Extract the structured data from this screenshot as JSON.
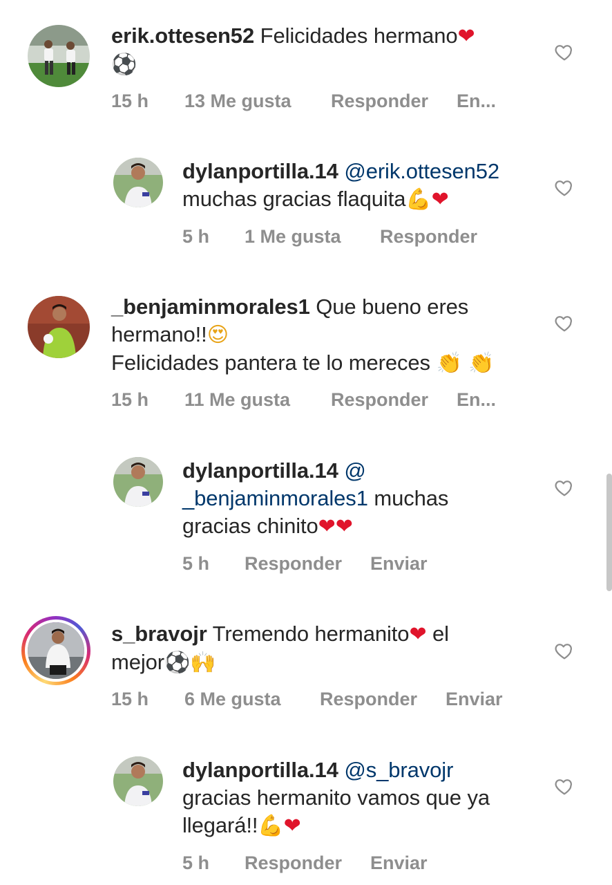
{
  "comments": [
    {
      "username": "erik.ottesen52",
      "text": " Felicidades hermano",
      "emoji1": "❤",
      "line2_emoji": "⚽",
      "time": "15 h",
      "likes": "13 Me gusta",
      "reply": "Responder",
      "send": "En..."
    },
    {
      "username": "dylanportilla.14",
      "mention": "@erik.ottesen52",
      "line2": "muchas gracias flaquita",
      "emoji_flex": "💪",
      "emoji_heart": "❤",
      "time": "5 h",
      "likes": "1 Me gusta",
      "reply": "Responder"
    },
    {
      "username": "_benjaminmorales1",
      "text": " Que bueno eres",
      "line2": "hermano!!",
      "emoji_eyes": "😍",
      "line3": "Felicidades pantera te lo mereces ",
      "emoji_clap": "👏 👏",
      "time": "15 h",
      "likes": "11 Me gusta",
      "reply": "Responder",
      "send": "En..."
    },
    {
      "username": "dylanportilla.14",
      "mention1": "@",
      "mention2": "_benjaminmorales1",
      "text2": " muchas",
      "line3": "gracias chinito",
      "emoji_hearts": "❤❤",
      "time": "5 h",
      "reply": "Responder",
      "send": "Enviar"
    },
    {
      "username": "s_bravojr",
      "text": " Tremendo hermanito",
      "emoji_heart": "❤",
      "text_after": " el",
      "line2": "mejor",
      "emoji_ball": "⚽",
      "emoji_hands": "🙌",
      "time": "15 h",
      "likes": "6 Me gusta",
      "reply": "Responder",
      "send": "Enviar"
    },
    {
      "username": "dylanportilla.14",
      "mention": "@s_bravojr",
      "line2": "gracias hermanito vamos que ya",
      "line3": "llegará!!",
      "emoji_flex": "💪",
      "emoji_heart": "❤",
      "time": "5 h",
      "reply": "Responder",
      "send": "Enviar"
    }
  ],
  "icons": {
    "like": "heart-outline-icon"
  },
  "colors": {
    "text": "#262626",
    "meta": "#8e8e8e",
    "mention": "#00376b",
    "heart": "#e0142b"
  }
}
